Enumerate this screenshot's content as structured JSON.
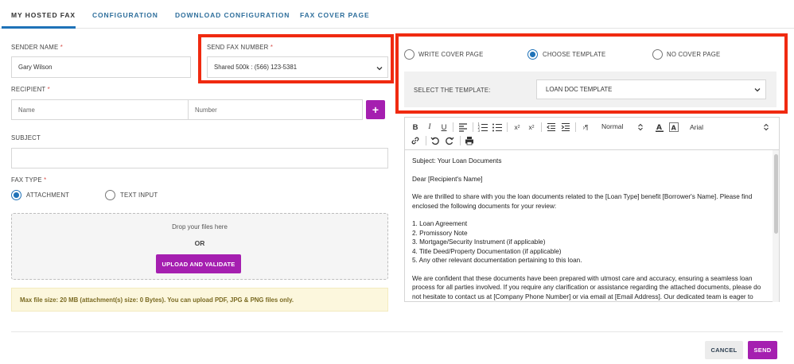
{
  "tabs": [
    "MY HOSTED FAX",
    "CONFIGURATION",
    "DOWNLOAD CONFIGURATION",
    "FAX COVER PAGE"
  ],
  "active_tab": "MY HOSTED FAX",
  "sender": {
    "label": "SENDER NAME",
    "value": "Gary Wilson"
  },
  "fax_number": {
    "label": "SEND FAX NUMBER",
    "value": "Shared 500k : (566) 123-5381"
  },
  "recipient": {
    "label": "RECIPIENT",
    "name_placeholder": "Name",
    "number_placeholder": "Number",
    "add_label": "+"
  },
  "subject": {
    "label": "SUBJECT",
    "value": ""
  },
  "fax_type": {
    "label": "FAX TYPE",
    "options": [
      "ATTACHMENT",
      "TEXT INPUT"
    ],
    "selected": "ATTACHMENT"
  },
  "dropzone": {
    "text": "Drop your files here",
    "or": "OR",
    "button": "UPLOAD AND VALIDATE"
  },
  "notice": "Max file size: 20 MB (attachment(s) size: 0 Bytes). You can upload PDF, JPG & PNG files only.",
  "cover": {
    "options": [
      "WRITE COVER PAGE",
      "CHOOSE TEMPLATE",
      "NO COVER PAGE"
    ],
    "selected": "CHOOSE TEMPLATE",
    "template_label": "SELECT THE TEMPLATE:",
    "template_value": "LOAN DOC TEMPLATE"
  },
  "editor": {
    "toolbar": {
      "format": "Normal",
      "font": "Arial"
    },
    "subject_line": "Subject: Your Loan Documents",
    "greeting": "Dear [Recipient's Name]",
    "para1": "We are thrilled to share with you the loan documents related to the [Loan Type] benefit [Borrower's Name]. Please find enclosed the following documents for your review:",
    "list": [
      "1. Loan Agreement",
      "2. Promissory Note",
      "3. Mortgage/Security Instrument (if applicable)",
      "4. Title Deed/Property Documentation (if applicable)",
      "5. Any other relevant documentation pertaining to this loan."
    ],
    "para2": "We are confident that these documents have been prepared with utmost care and accuracy, ensuring a seamless loan process for all parties involved. If you require any clarification or assistance regarding the attached documents, please do not hesitate to contact us at [Company Phone Number] or via email at [Email Address]. Our dedicated team is eager to"
  },
  "footer": {
    "cancel": "CANCEL",
    "send": "SEND"
  },
  "colors": {
    "accent": "#a51fb0",
    "tab_blue": "#2f6f9c",
    "radio_blue": "#1f72b8",
    "highlight_red": "#f02a10",
    "notice_bg": "#fcf7dd"
  }
}
